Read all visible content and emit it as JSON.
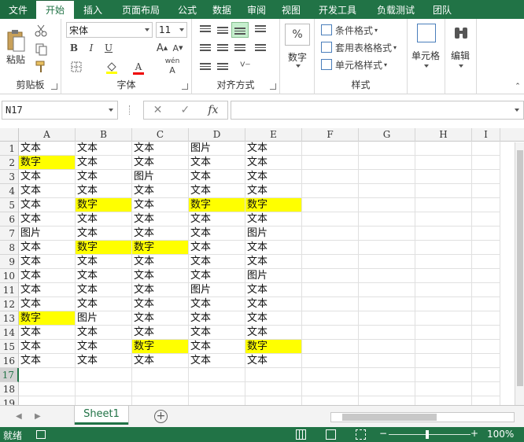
{
  "ribbon_tabs": [
    "文件",
    "开始",
    "插入",
    "页面布局",
    "公式",
    "数据",
    "审阅",
    "视图",
    "开发工具",
    "负载测试",
    "团队"
  ],
  "clipboard": {
    "paste_label": "粘贴",
    "group_label": "剪贴板"
  },
  "font": {
    "name": "宋体",
    "size": "11",
    "group_label": "字体",
    "bold": "B",
    "italic": "I",
    "underline": "U",
    "font_color_glyph": "A",
    "phonetic": "wén"
  },
  "alignment": {
    "group_label": "对齐方式"
  },
  "number": {
    "label": "数字",
    "percent": "%"
  },
  "styles": {
    "conditional": "条件格式",
    "table_format": "套用表格格式",
    "cell_styles": "单元格样式",
    "group_label": "样式"
  },
  "cells": {
    "label": "单元格"
  },
  "editing": {
    "label": "编辑"
  },
  "formula_bar": {
    "name_box": "N17",
    "cancel": "✕",
    "confirm": "✓",
    "fx": "fx",
    "value": ""
  },
  "columns": [
    "A",
    "B",
    "C",
    "D",
    "E",
    "F",
    "G",
    "H",
    "I"
  ],
  "rows": [
    [
      "文本",
      "文本",
      "文本",
      "图片",
      "文本"
    ],
    [
      "数字",
      "文本",
      "文本",
      "文本",
      "文本"
    ],
    [
      "文本",
      "文本",
      "图片",
      "文本",
      "文本"
    ],
    [
      "文本",
      "文本",
      "文本",
      "文本",
      "文本"
    ],
    [
      "文本",
      "数字",
      "文本",
      "数字",
      "数字"
    ],
    [
      "文本",
      "文本",
      "文本",
      "文本",
      "文本"
    ],
    [
      "图片",
      "文本",
      "文本",
      "文本",
      "图片"
    ],
    [
      "文本",
      "数字",
      "数字",
      "文本",
      "文本"
    ],
    [
      "文本",
      "文本",
      "文本",
      "文本",
      "文本"
    ],
    [
      "文本",
      "文本",
      "文本",
      "文本",
      "图片"
    ],
    [
      "文本",
      "文本",
      "文本",
      "图片",
      "文本"
    ],
    [
      "文本",
      "文本",
      "文本",
      "文本",
      "文本"
    ],
    [
      "数字",
      "图片",
      "文本",
      "文本",
      "文本"
    ],
    [
      "文本",
      "文本",
      "文本",
      "文本",
      "文本"
    ],
    [
      "文本",
      "文本",
      "数字",
      "文本",
      "数字"
    ],
    [
      "文本",
      "文本",
      "文本",
      "文本",
      "文本"
    ],
    [
      "",
      "",
      "",
      "",
      ""
    ],
    [
      "",
      "",
      "",
      "",
      ""
    ],
    [
      "",
      "",
      "",
      "",
      ""
    ]
  ],
  "row_numbers": [
    "1",
    "2",
    "3",
    "4",
    "5",
    "6",
    "7",
    "8",
    "9",
    "10",
    "11",
    "12",
    "13",
    "14",
    "15",
    "16",
    "17",
    "18",
    "19"
  ],
  "selected_row": "17",
  "highlight_color": "#ffff00",
  "highlight_value": "数字",
  "sheet_tab": "Sheet1",
  "status": {
    "ready": "就绪",
    "zoom": "100%"
  },
  "colors": {
    "accent": "#217346"
  }
}
